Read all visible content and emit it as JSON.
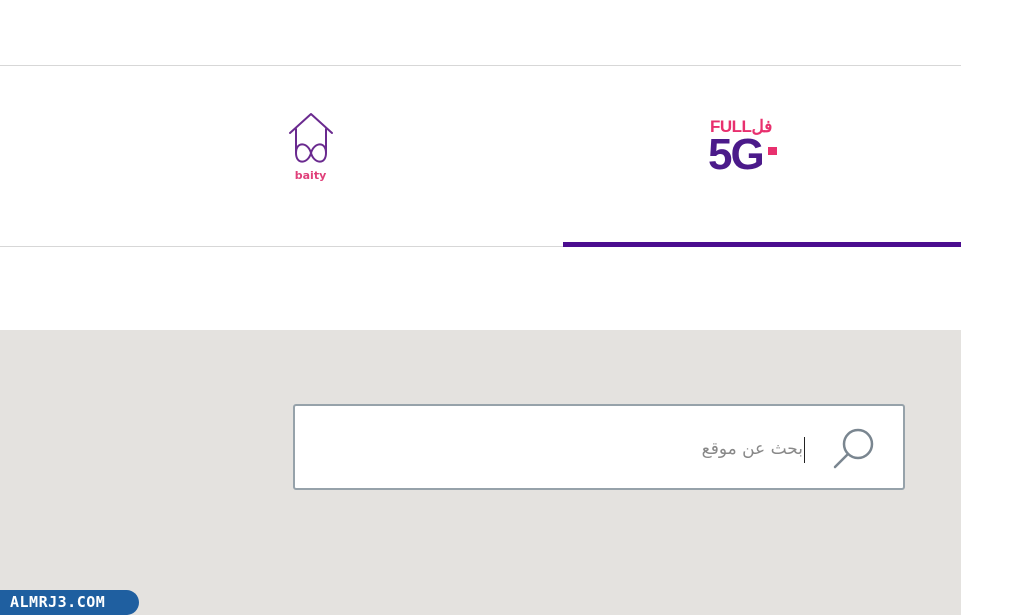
{
  "tabs": {
    "five_g": {
      "full_label": "FULLفل",
      "main_label": "5G",
      "selected": true,
      "accent_color": "#e8306e",
      "main_color": "#4b1a8a"
    },
    "baity": {
      "label": "baity",
      "icon": "house-infinity-icon",
      "color": "#e0407a"
    },
    "indicator_color": "#4b0d8f"
  },
  "search": {
    "placeholder": "بحث عن موقع",
    "value": "",
    "icon": "search-icon"
  },
  "watermark": {
    "text": "ALMRJ3.COM"
  }
}
